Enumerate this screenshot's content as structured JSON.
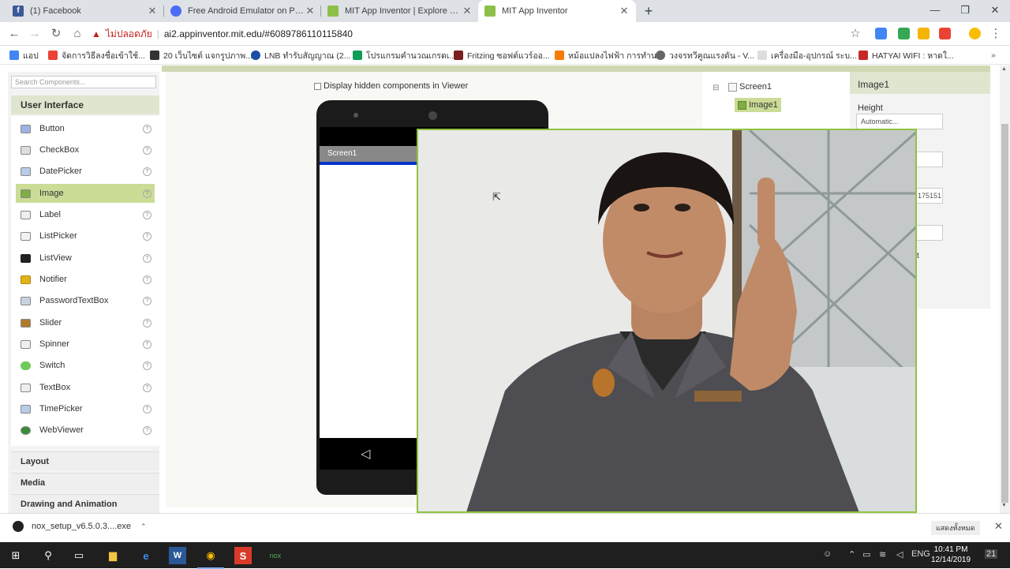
{
  "browser": {
    "tabs": [
      {
        "title": "(1) Facebook",
        "favicon_color": "#3b5998",
        "active": false
      },
      {
        "title": "Free Android Emulator on PC and",
        "favicon_color": "#4a6cf7",
        "active": false
      },
      {
        "title": "MIT App Inventor | Explore MIT A",
        "favicon_color": "#8cc04a",
        "active": false
      },
      {
        "title": "MIT App Inventor",
        "favicon_color": "#8cc04a",
        "active": true
      }
    ],
    "insecure_label": "ไม่ปลอดภัย",
    "url": "ai2.appinventor.mit.edu/#6089786110115840",
    "bookmarks": [
      {
        "label": "แอป",
        "color": "#4285f4"
      },
      {
        "label": "จัดการวิธีลงชื่อเข้าใช้...",
        "color": "#ea4335"
      },
      {
        "label": "20 เว็บไซต์ แจกรูปภาพ...",
        "color": "#333333"
      },
      {
        "label": "LNB ทำรับสัญญาณ (2...",
        "color": "#1a4fa3"
      },
      {
        "label": "โปรแกรมคำนวณเกรดเ...",
        "color": "#0f9d58"
      },
      {
        "label": "Fritzing ซอฟต์แวร์ออ...",
        "color": "#7b1f1f"
      },
      {
        "label": "หม้อแปลงไฟฟ้า การทำน...",
        "color": "#f57c00"
      },
      {
        "label": "วงจรทวีคูณแรงดัน - V...",
        "color": "#666666"
      },
      {
        "label": "เครื่องมือ-อุปกรณ์ ระบ...",
        "color": "#999999"
      },
      {
        "label": "HATYAI WIFI : หาดใ...",
        "color": "#c62828"
      }
    ]
  },
  "palette": {
    "search_placeholder": "Search Components...",
    "ui_header": "User Interface",
    "items": [
      {
        "label": "Button",
        "icon": "button-icon",
        "color": "#6a8ad0"
      },
      {
        "label": "CheckBox",
        "icon": "checkbox-icon",
        "color": "#555555"
      },
      {
        "label": "DatePicker",
        "icon": "datepicker-icon",
        "color": "#7aa0d6"
      },
      {
        "label": "Image",
        "icon": "image-icon",
        "color": "#7fae45",
        "selected": true
      },
      {
        "label": "Label",
        "icon": "label-icon",
        "color": "#bbbbbb"
      },
      {
        "label": "ListPicker",
        "icon": "listpicker-icon",
        "color": "#cccccc"
      },
      {
        "label": "ListView",
        "icon": "listview-icon",
        "color": "#222222"
      },
      {
        "label": "Notifier",
        "icon": "notifier-icon",
        "color": "#e3b21a"
      },
      {
        "label": "PasswordTextBox",
        "icon": "password-icon",
        "color": "#9aa7c0"
      },
      {
        "label": "Slider",
        "icon": "slider-icon",
        "color": "#b07b2a"
      },
      {
        "label": "Spinner",
        "icon": "spinner-icon",
        "color": "#bbbbbb"
      },
      {
        "label": "Switch",
        "icon": "switch-icon",
        "color": "#6ecb5a"
      },
      {
        "label": "TextBox",
        "icon": "textbox-icon",
        "color": "#bbbbbb"
      },
      {
        "label": "TimePicker",
        "icon": "timepicker-icon",
        "color": "#7aa0d6"
      },
      {
        "label": "WebViewer",
        "icon": "webviewer-icon",
        "color": "#3a8c3a"
      }
    ],
    "categories": [
      "Layout",
      "Media",
      "Drawing and Animation"
    ],
    "help_glyph": "?"
  },
  "viewer": {
    "hidden_components_label": "Display hidden components in Viewer",
    "screen_title": "Screen1",
    "back_glyph": "◁"
  },
  "tree": {
    "root": "Screen1",
    "child": "Image1",
    "collapse_glyph": "⊟"
  },
  "properties": {
    "component": "Image1",
    "height_label": "Height",
    "height_value": "Automatic...",
    "partial_value": "175151",
    "partial_char": "t"
  },
  "downloads": {
    "file": "nox_setup_v6.5.0.3....exe",
    "show_all": "แสดงทั้งหมด"
  },
  "taskbar": {
    "lang": "ENG",
    "time": "10:41 PM",
    "date": "12/14/2019",
    "notifications": "21"
  },
  "colors": {
    "accent_green": "#8fc440",
    "selected_bg": "#cbdc97",
    "header_bg": "#dfe6cf"
  }
}
